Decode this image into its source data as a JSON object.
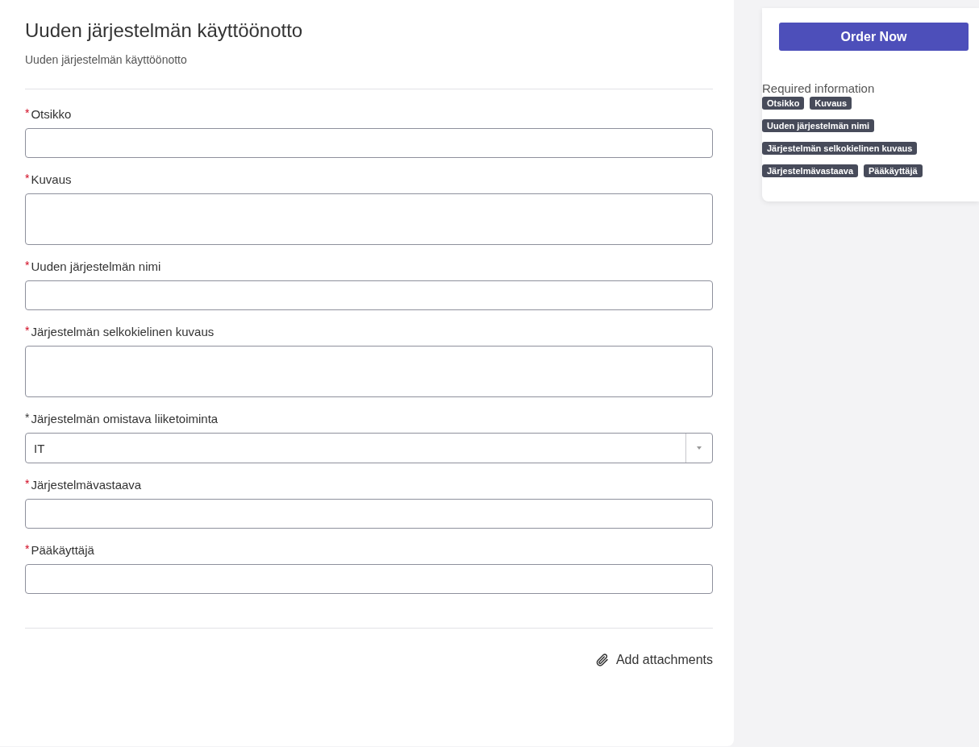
{
  "form": {
    "title": "Uuden järjestelmän käyttöönotto",
    "subtitle": "Uuden järjestelmän käyttöönotto",
    "fields": [
      {
        "kind": "text",
        "marker": "*",
        "required": true,
        "label": "Otsikko"
      },
      {
        "kind": "textarea",
        "marker": "*",
        "required": true,
        "label": "Kuvaus"
      },
      {
        "kind": "text",
        "marker": "*",
        "required": true,
        "label": "Uuden järjestelmän nimi"
      },
      {
        "kind": "textarea",
        "marker": "*",
        "required": true,
        "label": "Järjestelmän selkokielinen kuvaus"
      },
      {
        "kind": "select",
        "marker": "*",
        "required": false,
        "label": "Järjestelmän omistava liiketoiminta",
        "value": "IT"
      },
      {
        "kind": "text",
        "marker": "*",
        "required": true,
        "label": "Järjestelmävastaava"
      },
      {
        "kind": "text",
        "marker": "*",
        "required": true,
        "label": "Pääkäyttäjä"
      }
    ],
    "attachments": "Add attachments"
  },
  "sidebar": {
    "button": "Order Now",
    "heading": "Required information",
    "tag_rows": [
      [
        "Otsikko",
        "Kuvaus"
      ],
      [
        "Uuden järjestelmän nimi"
      ],
      [
        "Järjestelmän selkokielinen kuvaus"
      ],
      [
        "Järjestelmävastaava",
        "Pääkäyttäjä"
      ]
    ]
  }
}
